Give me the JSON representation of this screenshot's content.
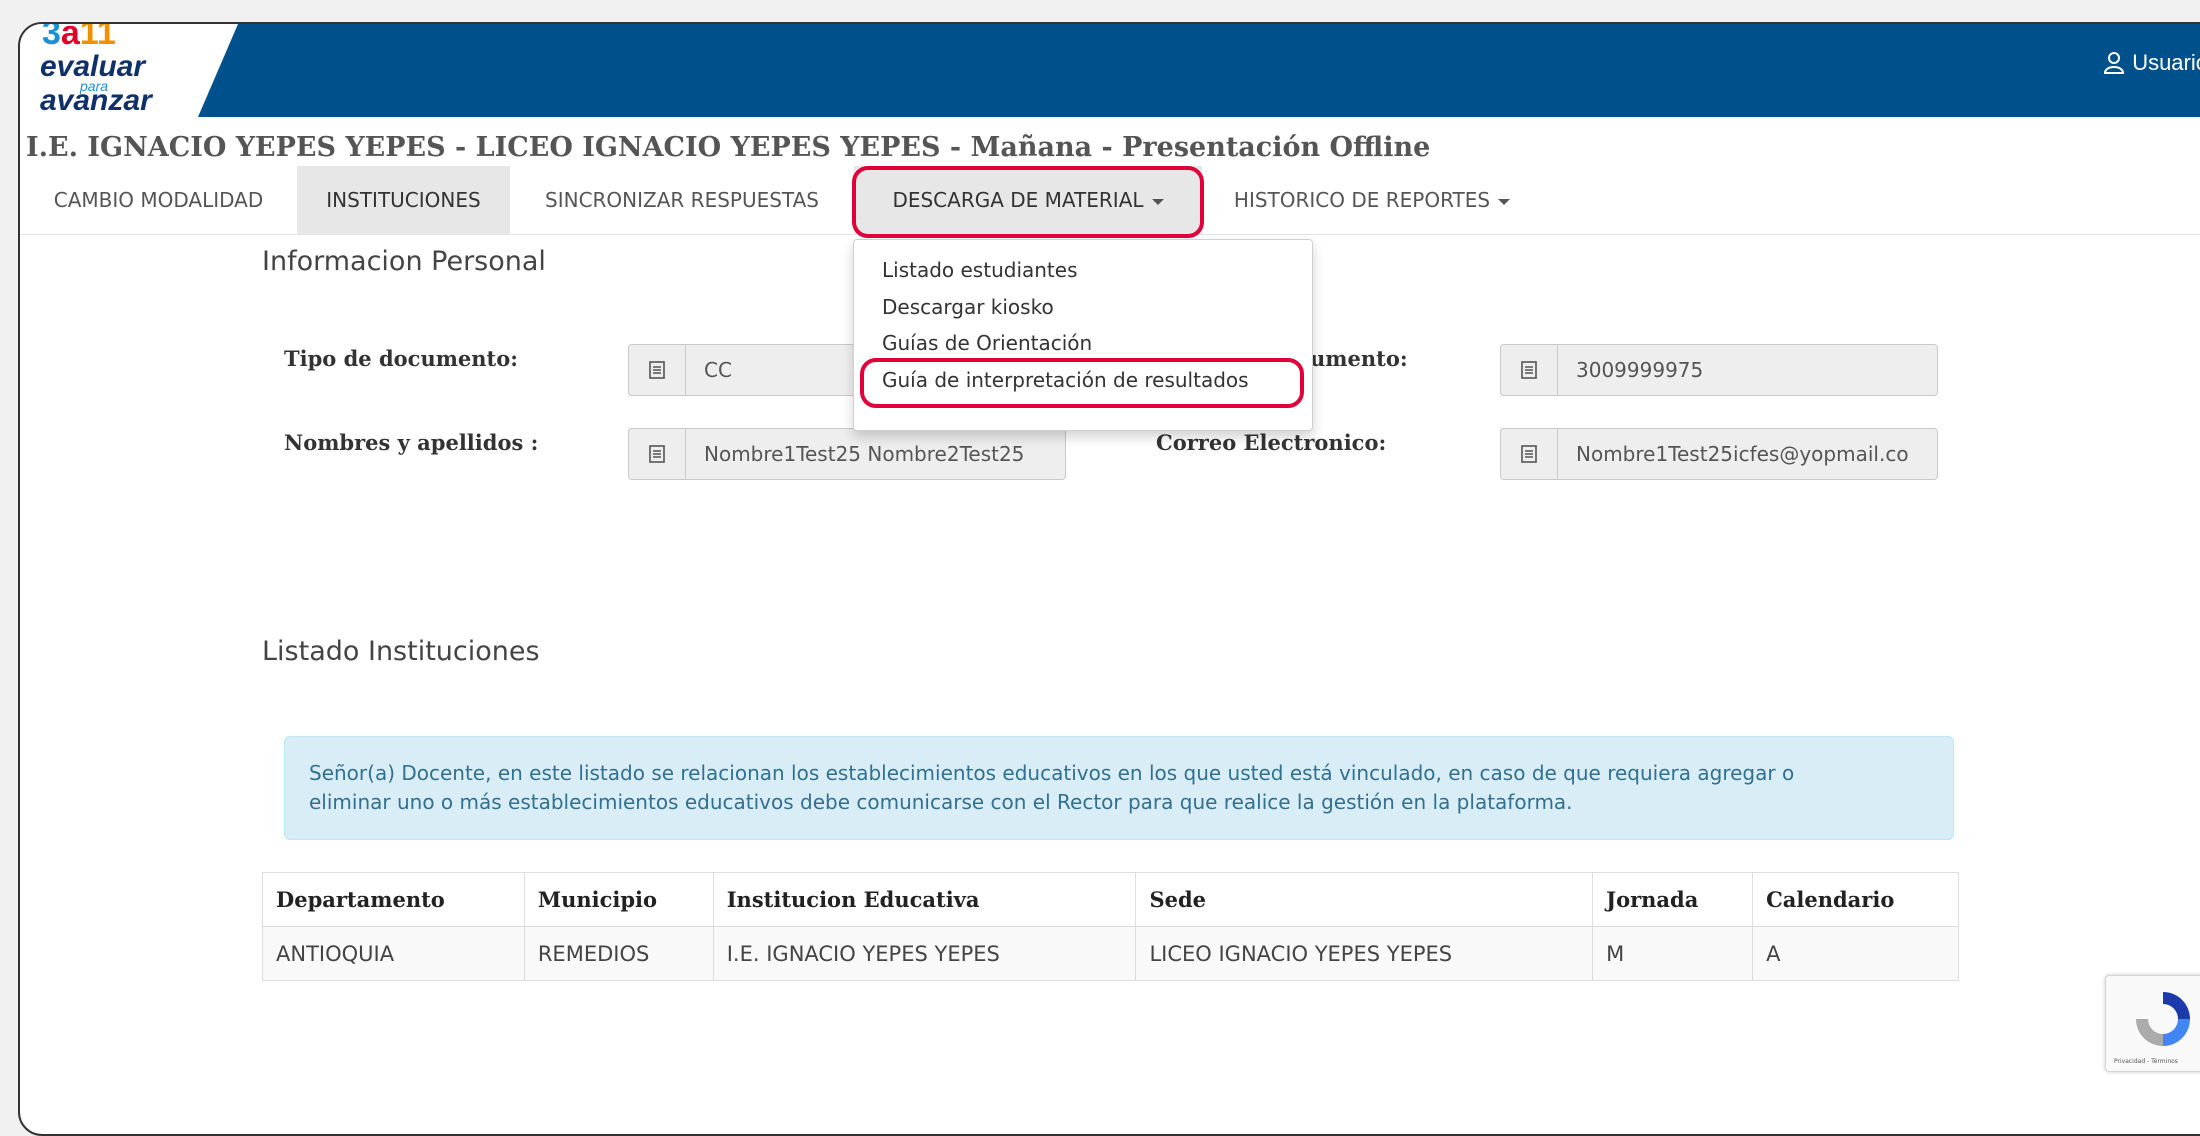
{
  "header": {
    "logo": {
      "nums": {
        "three": "3",
        "a": "a",
        "eleven": "11"
      },
      "word1": "evaluar",
      "word2": "para",
      "word3": "avanzar"
    },
    "user_label": "Usuario"
  },
  "institution_title": "I.E. IGNACIO YEPES YEPES - LICEO IGNACIO YEPES YEPES - Mañana - Presentación Offline",
  "nav": {
    "cambio": "CAMBIO MODALIDAD",
    "instituciones": "INSTITUCIONES",
    "sincronizar": "SINCRONIZAR RESPUESTAS",
    "descarga": "DESCARGA DE MATERIAL",
    "historico": "HISTORICO DE REPORTES"
  },
  "dropdown": {
    "items": [
      "Listado estudiantes",
      "Descargar kiosko",
      "Guías de Orientación",
      "Guía de interpretación de resultados"
    ]
  },
  "personal": {
    "title": "Informacion Personal",
    "tipo_label": "Tipo de documento:",
    "tipo_value": "CC",
    "numero_label": "umento:",
    "numero_value": "3009999975",
    "nombres_label": "Nombres y apellidos :",
    "nombres_value": "Nombre1Test25 Nombre2Test25",
    "correo_label": "Correo Electronico:",
    "correo_value": "Nombre1Test25icfes@yopmail.co"
  },
  "listado": {
    "title": "Listado Instituciones",
    "alert_line1": "Señor(a) Docente, en este listado se relacionan los establecimientos educativos en los que usted está vinculado, en caso de que requiera agregar o",
    "alert_line2": "eliminar uno o más establecimientos educativos debe comunicarse con el Rector para que realice la gestión en la plataforma.",
    "columns": [
      "Departamento",
      "Municipio",
      "Institucion Educativa",
      "Sede",
      "Jornada",
      "Calendario"
    ],
    "rows": [
      [
        "ANTIOQUIA",
        "REMEDIOS",
        "I.E. IGNACIO YEPES YEPES",
        "LICEO IGNACIO YEPES YEPES",
        "M",
        "A"
      ]
    ]
  },
  "recaptcha": {
    "text": "Privacidad - Términos"
  },
  "colors": {
    "header_blue": "#00508b",
    "highlight_red": "#e2003b",
    "alert_bg": "#d9edf7",
    "alert_text": "#31708f"
  }
}
